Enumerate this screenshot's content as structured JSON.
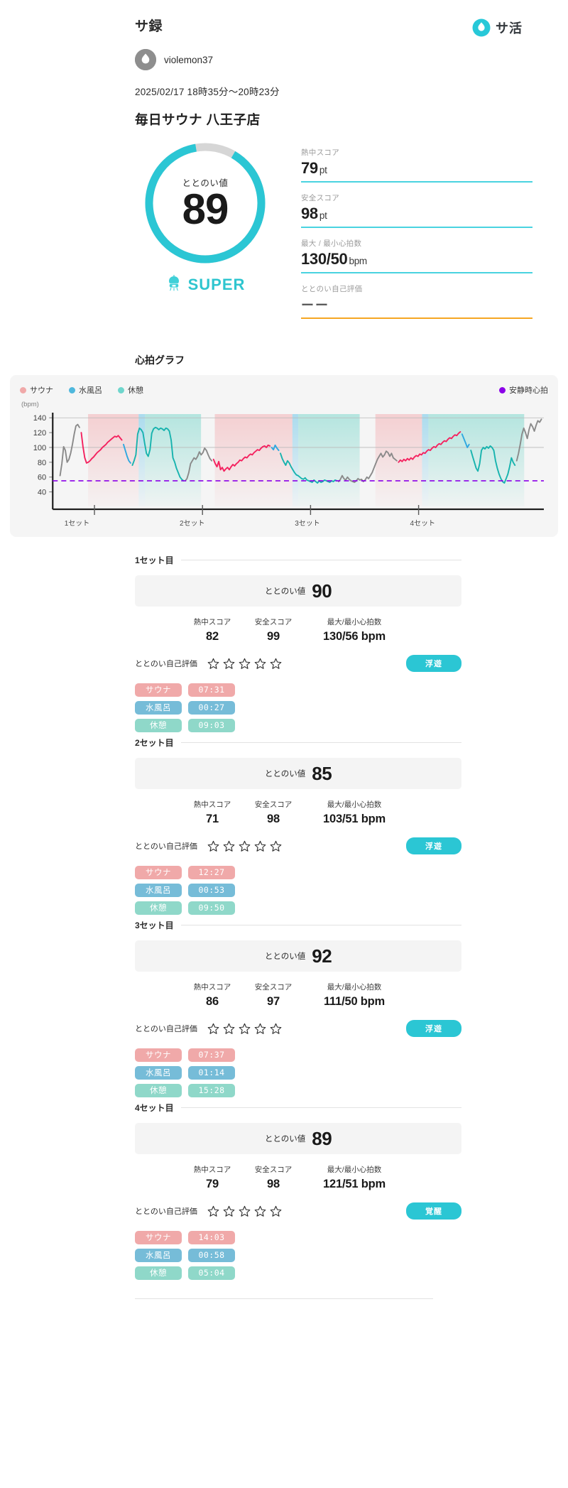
{
  "header": {
    "section_title": "サ録",
    "brand_name": "サ活",
    "brand_icon": "water-drop-icon",
    "avatar_icon": "water-drop-icon",
    "user_name": "violemon37",
    "date_range": "2025/02/17 18時35分〜20時23分",
    "venue": "毎日サウナ 八王子店"
  },
  "summary": {
    "ring_label": "ととのい値",
    "ring_value": "89",
    "ring_percent": 89,
    "verdict": "SUPER",
    "verdict_icon": "jellyfish-icon",
    "stats": [
      {
        "label": "熱中スコア",
        "value": "79",
        "unit": "pt",
        "rule_color": "#49d3e0"
      },
      {
        "label": "安全スコア",
        "value": "98",
        "unit": "pt",
        "rule_color": "#49d3e0"
      },
      {
        "label": "最大 / 最小心拍数",
        "value": "130/50",
        "unit": "bpm",
        "rule_color": "#49d3e0"
      },
      {
        "label": "ととのい自己評価",
        "value": "ーー",
        "unit": "",
        "rule_color": "#f5a623"
      }
    ]
  },
  "chart": {
    "heading": "心拍グラフ",
    "unit_label": "(bpm)",
    "legend": [
      {
        "label": "サウナ",
        "color": "#f0a9a9",
        "name": "legend-sauna"
      },
      {
        "label": "水風呂",
        "color": "#4fb8dd",
        "name": "legend-coldbath"
      },
      {
        "label": "休憩",
        "color": "#6fd6cd",
        "name": "legend-rest"
      },
      {
        "label": "安静時心拍",
        "color": "#8b00e8",
        "name": "legend-resting-hr"
      }
    ]
  },
  "chart_data": {
    "type": "line",
    "title": "心拍グラフ",
    "xlabel": "",
    "ylabel": "(bpm)",
    "ylim": [
      30,
      145
    ],
    "yticks": [
      40,
      60,
      80,
      100,
      120,
      140
    ],
    "grid": true,
    "legend_position": "top",
    "resting_hr": 55,
    "resting_hr_label": "安静時心拍",
    "xticks": [
      "1セット",
      "2セット",
      "3セット",
      "4セット"
    ],
    "xtick_positions": [
      0.085,
      0.305,
      0.525,
      0.745
    ],
    "phase_bands": [
      {
        "phase": "サウナ",
        "start": 0.072,
        "end": 0.175,
        "color": "#f3b0b4"
      },
      {
        "phase": "水風呂",
        "start": 0.175,
        "end": 0.188,
        "color": "#6ec6e8"
      },
      {
        "phase": "休憩",
        "start": 0.188,
        "end": 0.302,
        "color": "#7fd8cd"
      },
      {
        "phase": "サウナ",
        "start": 0.33,
        "end": 0.488,
        "color": "#f3b0b4"
      },
      {
        "phase": "水風呂",
        "start": 0.488,
        "end": 0.5,
        "color": "#6ec6e8"
      },
      {
        "phase": "休憩",
        "start": 0.5,
        "end": 0.625,
        "color": "#7fd8cd"
      },
      {
        "phase": "サウナ",
        "start": 0.657,
        "end": 0.752,
        "color": "#f3b0b4"
      },
      {
        "phase": "水風呂",
        "start": 0.752,
        "end": 0.765,
        "color": "#6ec6e8"
      },
      {
        "phase": "休憩",
        "start": 0.765,
        "end": 0.96,
        "color": "#7fd8cd"
      }
    ],
    "series": [
      {
        "name": "心拍数",
        "segments": [
          {
            "phase": "none",
            "color": "#8a8a8a",
            "points": [
              62,
              78,
              101,
              96,
              80,
              84,
              92,
              104,
              118,
              129,
              131,
              127
            ]
          },
          {
            "phase": "サウナ",
            "color": "#f4225f",
            "points": [
              120,
              101,
              86,
              79,
              80,
              82,
              85,
              87,
              90,
              93,
              95,
              97,
              100,
              102,
              104,
              107,
              109,
              111,
              113,
              115,
              114,
              116,
              113,
              110
            ]
          },
          {
            "phase": "水風呂",
            "color": "#2fa8e0",
            "points": [
              104,
              96,
              88,
              82,
              79
            ]
          },
          {
            "phase": "休憩",
            "color": "#17b3ae",
            "points": [
              76,
              82,
              90,
              118,
              126,
              124,
              120,
              105,
              92,
              88,
              97,
              119,
              125,
              127,
              126,
              124,
              126,
              125,
              123,
              126,
              125,
              122,
              110,
              86,
              80,
              72,
              66,
              60,
              57,
              55
            ]
          },
          {
            "phase": "none",
            "color": "#8a8a8a",
            "points": [
              55,
              58,
              66,
              78,
              82,
              86,
              84,
              88,
              94,
              90,
              93,
              99,
              96,
              90,
              85,
              82
            ]
          },
          {
            "phase": "サウナ",
            "color": "#f4225f",
            "points": [
              84,
              78,
              74,
              81,
              70,
              73,
              68,
              71,
              73,
              70,
              74,
              77,
              75,
              78,
              80,
              83,
              82,
              85,
              87,
              86,
              89,
              91,
              90,
              93,
              95,
              97,
              96,
              99,
              101,
              102,
              100,
              103,
              102
            ]
          },
          {
            "phase": "水風呂",
            "color": "#2fa8e0",
            "points": [
              100,
              97,
              103,
              99,
              96
            ]
          },
          {
            "phase": "休憩",
            "color": "#17b3ae",
            "points": [
              92,
              85,
              80,
              76,
              82,
              79,
              74,
              70,
              66,
              63,
              62,
              60,
              58,
              57,
              59,
              56,
              55,
              54,
              53,
              56,
              54,
              52,
              55,
              53,
              54,
              56,
              55,
              54,
              53,
              55,
              54,
              56,
              55
            ]
          },
          {
            "phase": "none",
            "color": "#8a8a8a",
            "points": [
              54,
              57,
              62,
              58,
              56,
              60,
              57,
              55,
              54,
              53,
              55,
              58,
              56,
              57,
              54,
              56,
              60,
              58,
              62,
              66,
              72,
              78,
              84,
              88,
              92,
              87,
              90,
              95,
              93,
              88,
              92,
              86,
              84,
              82
            ]
          },
          {
            "phase": "サウナ",
            "color": "#f4225f",
            "points": [
              80,
              83,
              81,
              84,
              82,
              85,
              83,
              86,
              84,
              87,
              89,
              88,
              91,
              90,
              93,
              92,
              95,
              97,
              96,
              99,
              101,
              100,
              103,
              105,
              104,
              107,
              109,
              108,
              111,
              113,
              112,
              115,
              117,
              116,
              119,
              121
            ]
          },
          {
            "phase": "水風呂",
            "color": "#2fa8e0",
            "points": [
              118,
              112,
              106,
              100,
              104
            ]
          },
          {
            "phase": "休憩",
            "color": "#17b3ae",
            "points": [
              96,
              88,
              80,
              72,
              68,
              78,
              96,
              100,
              98,
              101,
              99,
              102,
              100,
              96,
              82,
              72,
              64,
              58,
              54,
              52,
              58,
              64,
              74,
              86,
              80,
              76
            ]
          },
          {
            "phase": "none",
            "color": "#8a8a8a",
            "points": [
              82,
              92,
              104,
              118,
              126,
              120,
              112,
              124,
              132,
              128,
              122,
              130,
              136,
              134,
              138
            ]
          }
        ]
      }
    ]
  },
  "sets": [
    {
      "title": "1セット目",
      "totonoi_label": "ととのい値",
      "totonoi_value": "90",
      "metrics": [
        {
          "label": "熱中スコア",
          "value": "82"
        },
        {
          "label": "安全スコア",
          "value": "99"
        },
        {
          "label": "最大/最小心拍数",
          "value": "130/56 bpm"
        }
      ],
      "rating_label": "ととのい自己評価",
      "stars_filled": 0,
      "stars_total": 5,
      "badge": "浮遊",
      "chips": [
        {
          "name": "サウナ",
          "time": "07:31",
          "kind": "sauna"
        },
        {
          "name": "水風呂",
          "time": "00:27",
          "kind": "bath"
        },
        {
          "name": "休憩",
          "time": "09:03",
          "kind": "rest"
        }
      ]
    },
    {
      "title": "2セット目",
      "totonoi_label": "ととのい値",
      "totonoi_value": "85",
      "metrics": [
        {
          "label": "熱中スコア",
          "value": "71"
        },
        {
          "label": "安全スコア",
          "value": "98"
        },
        {
          "label": "最大/最小心拍数",
          "value": "103/51 bpm"
        }
      ],
      "rating_label": "ととのい自己評価",
      "stars_filled": 0,
      "stars_total": 5,
      "badge": "浮遊",
      "chips": [
        {
          "name": "サウナ",
          "time": "12:27",
          "kind": "sauna"
        },
        {
          "name": "水風呂",
          "time": "00:53",
          "kind": "bath"
        },
        {
          "name": "休憩",
          "time": "09:50",
          "kind": "rest"
        }
      ]
    },
    {
      "title": "3セット目",
      "totonoi_label": "ととのい値",
      "totonoi_value": "92",
      "metrics": [
        {
          "label": "熱中スコア",
          "value": "86"
        },
        {
          "label": "安全スコア",
          "value": "97"
        },
        {
          "label": "最大/最小心拍数",
          "value": "111/50 bpm"
        }
      ],
      "rating_label": "ととのい自己評価",
      "stars_filled": 0,
      "stars_total": 5,
      "badge": "浮遊",
      "chips": [
        {
          "name": "サウナ",
          "time": "07:37",
          "kind": "sauna"
        },
        {
          "name": "水風呂",
          "time": "01:14",
          "kind": "bath"
        },
        {
          "name": "休憩",
          "time": "15:28",
          "kind": "rest"
        }
      ]
    },
    {
      "title": "4セット目",
      "totonoi_label": "ととのい値",
      "totonoi_value": "89",
      "metrics": [
        {
          "label": "熱中スコア",
          "value": "79"
        },
        {
          "label": "安全スコア",
          "value": "98"
        },
        {
          "label": "最大/最小心拍数",
          "value": "121/51 bpm"
        }
      ],
      "rating_label": "ととのい自己評価",
      "stars_filled": 0,
      "stars_total": 5,
      "badge": "覚醒",
      "chips": [
        {
          "name": "サウナ",
          "time": "14:03",
          "kind": "sauna"
        },
        {
          "name": "水風呂",
          "time": "00:58",
          "kind": "bath"
        },
        {
          "name": "休憩",
          "time": "05:04",
          "kind": "rest"
        }
      ]
    }
  ],
  "theme": {
    "accent": "#2bc6d4",
    "ring_track": "#d6d6d6",
    "sauna": "#f0a9a9",
    "bath": "#76bcd8",
    "rest": "#8fd8c9"
  }
}
